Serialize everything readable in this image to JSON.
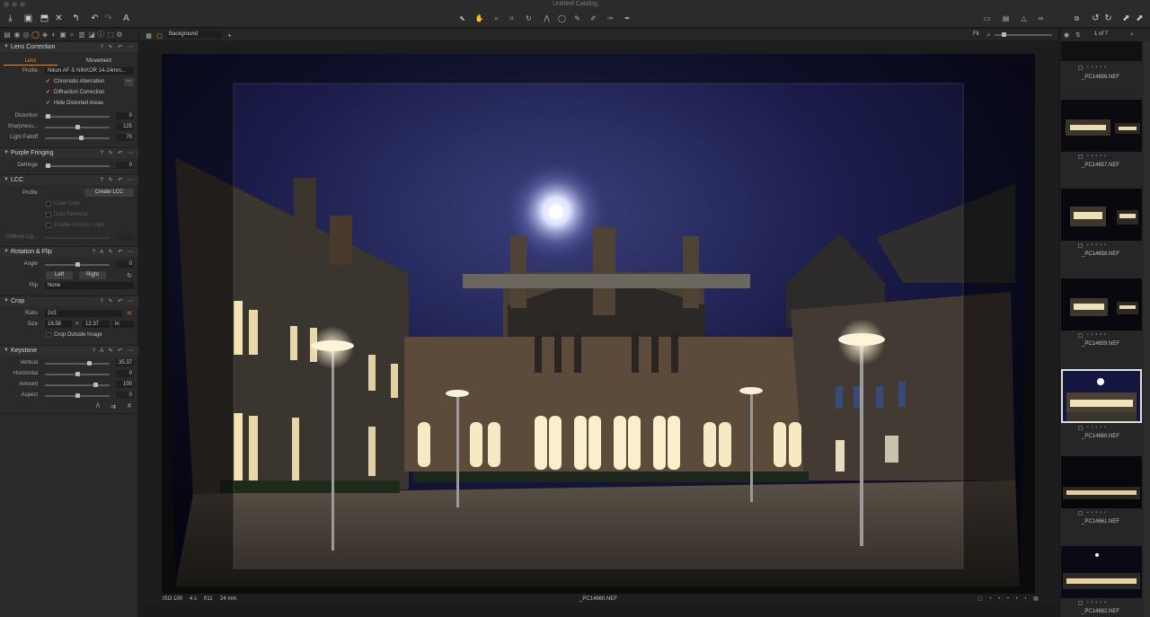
{
  "window": {
    "title": "Untitled Catalog"
  },
  "viewer": {
    "variant": "Background",
    "zoom_label": "Fit",
    "filename": "_PC14660.NEF",
    "iso": "ISO 100",
    "shutter": "4 s",
    "aperture": "f/11",
    "focal": "24 mm"
  },
  "browser": {
    "counter": "1 of 7",
    "thumbs": [
      {
        "name": "_PC14656.NEF"
      },
      {
        "name": "_PC14657.NEF"
      },
      {
        "name": "_PC14658.NEF"
      },
      {
        "name": "_PC14659.NEF"
      },
      {
        "name": "_PC14660.NEF"
      },
      {
        "name": "_PC14661.NEF"
      },
      {
        "name": "_PC14662.NEF"
      }
    ],
    "selected_index": 4
  },
  "lens_correction": {
    "title": "Lens Correction",
    "tabs": [
      "Lens",
      "Movement"
    ],
    "profile_label": "Profile",
    "profile_value": "Nikon AF-S NIKKOR 14-24mm...",
    "options": [
      {
        "label": "Chromatic Aberration",
        "checked": true
      },
      {
        "label": "Diffraction Correction",
        "checked": true
      },
      {
        "label": "Hide Distorted Areas",
        "checked": true
      }
    ],
    "sliders": [
      {
        "label": "Distortion",
        "value": "0",
        "level": 0.0
      },
      {
        "label": "Sharpness...",
        "value": "125",
        "level": 0.62
      },
      {
        "label": "Light Falloff",
        "value": "70",
        "level": 0.7
      }
    ]
  },
  "purple_fringing": {
    "title": "Purple Fringing",
    "sliders": [
      {
        "label": "Defringe",
        "value": "0",
        "level": 0.0
      }
    ]
  },
  "lcc": {
    "title": "LCC",
    "profile_label": "Profile",
    "create_button": "Create LCC",
    "options": [
      {
        "label": "Color Cast"
      },
      {
        "label": "Dust Removal"
      },
      {
        "label": "Enable Uniform Light"
      }
    ],
    "uniform_label": "Uniform Lig..."
  },
  "rotation": {
    "title": "Rotation & Flip",
    "angle_label": "Angle",
    "angle_value": "0",
    "left_button": "Left",
    "right_button": "Right",
    "flip_label": "Flip",
    "flip_value": "None"
  },
  "crop": {
    "title": "Crop",
    "ratio_label": "Ratio",
    "ratio_value": "2x3",
    "size_label": "Size",
    "width": "18.56",
    "times": "×",
    "height": "12.37",
    "unit": "in",
    "outside_label": "Crop Outside Image"
  },
  "keystone": {
    "title": "Keystone",
    "sliders": [
      {
        "label": "Vertical",
        "value": "35.37",
        "level": 0.68
      },
      {
        "label": "Horizontal",
        "value": "0",
        "level": 0.5
      },
      {
        "label": "Amount",
        "value": "100",
        "level": 0.75
      },
      {
        "label": "Aspect",
        "value": "0",
        "level": 0.5
      }
    ]
  }
}
